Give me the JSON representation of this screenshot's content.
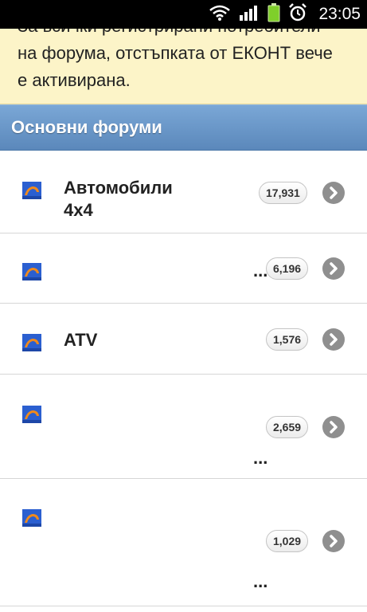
{
  "status_bar": {
    "time": "23:05",
    "icons": [
      "wifi-icon",
      "signal-icon",
      "battery-icon",
      "alarm-icon"
    ]
  },
  "notice": {
    "lines": [
      "За всички регистрирани потребители",
      "на форума, отстъпката от ЕКОНТ вече",
      "е активирана."
    ],
    "background": "#fcf4c8"
  },
  "section": {
    "title": "Основни форуми",
    "header_color": "#6a97c9"
  },
  "forums": [
    {
      "title_line1": "Автомобили",
      "title_line2": "4x4",
      "count": "17,931",
      "ellipsis": ""
    },
    {
      "title_line1": "",
      "title_line2": "",
      "count": "6,196",
      "ellipsis": "..."
    },
    {
      "title_line1": "ATV",
      "title_line2": "",
      "count": "1,576",
      "ellipsis": ""
    },
    {
      "title_line1": "",
      "title_line2": "",
      "count": "2,659",
      "ellipsis": "..."
    },
    {
      "title_line1": "",
      "title_line2": "",
      "count": "1,029",
      "ellipsis": "..."
    }
  ]
}
